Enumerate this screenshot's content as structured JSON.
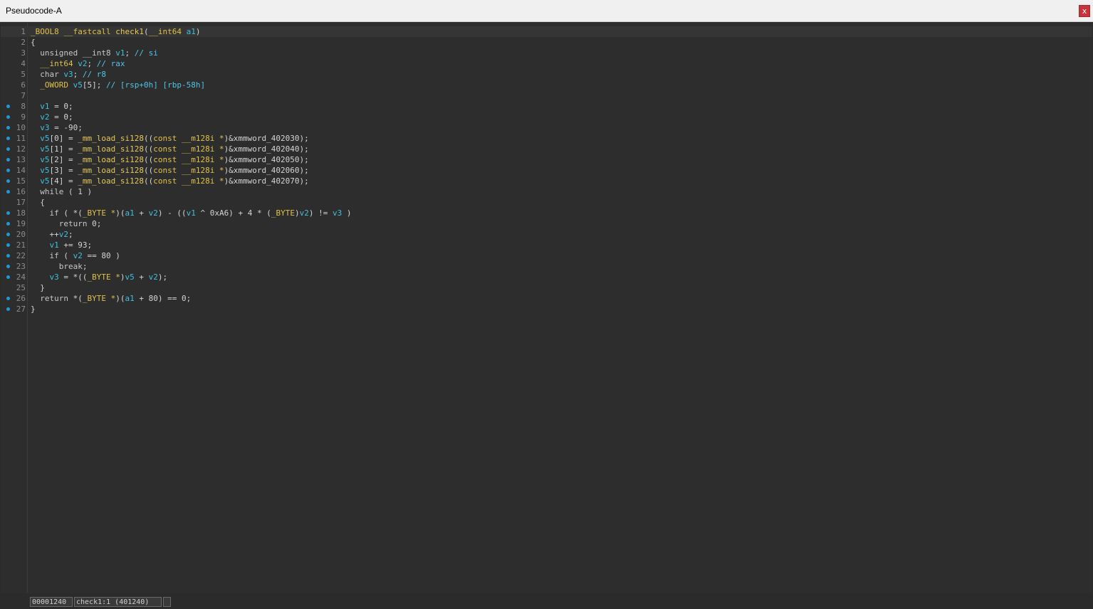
{
  "window": {
    "title": "Pseudocode-A",
    "close_label": "x"
  },
  "breakpoint_color": "#1e9bd7",
  "lines": [
    {
      "n": "1",
      "bp": false,
      "tokens": [
        [
          "type",
          "_BOOL8"
        ],
        [
          "plain",
          " "
        ],
        [
          "type",
          "__fastcall"
        ],
        [
          "plain",
          " "
        ],
        [
          "func",
          "check1"
        ],
        [
          "plain",
          "("
        ],
        [
          "type",
          "__int64"
        ],
        [
          "plain",
          " "
        ],
        [
          "var",
          "a1"
        ],
        [
          "plain",
          ")"
        ]
      ]
    },
    {
      "n": "2",
      "bp": false,
      "tokens": [
        [
          "plain",
          "{"
        ]
      ]
    },
    {
      "n": "3",
      "bp": false,
      "tokens": [
        [
          "plain",
          "  "
        ],
        [
          "kw",
          "unsigned __int8"
        ],
        [
          "plain",
          " "
        ],
        [
          "var",
          "v1"
        ],
        [
          "plain",
          "; "
        ],
        [
          "cmt",
          "// si"
        ]
      ]
    },
    {
      "n": "4",
      "bp": false,
      "tokens": [
        [
          "plain",
          "  "
        ],
        [
          "type",
          "__int64"
        ],
        [
          "plain",
          " "
        ],
        [
          "var",
          "v2"
        ],
        [
          "plain",
          "; "
        ],
        [
          "cmt",
          "// rax"
        ]
      ]
    },
    {
      "n": "5",
      "bp": false,
      "tokens": [
        [
          "plain",
          "  "
        ],
        [
          "kw",
          "char"
        ],
        [
          "plain",
          " "
        ],
        [
          "var",
          "v3"
        ],
        [
          "plain",
          "; "
        ],
        [
          "cmt",
          "// r8"
        ]
      ]
    },
    {
      "n": "6",
      "bp": false,
      "tokens": [
        [
          "plain",
          "  "
        ],
        [
          "type",
          "_OWORD"
        ],
        [
          "plain",
          " "
        ],
        [
          "var",
          "v5"
        ],
        [
          "plain",
          "[5]; "
        ],
        [
          "cmt",
          "// [rsp+0h] [rbp-58h]"
        ]
      ]
    },
    {
      "n": "7",
      "bp": false,
      "tokens": []
    },
    {
      "n": "8",
      "bp": true,
      "tokens": [
        [
          "plain",
          "  "
        ],
        [
          "var",
          "v1"
        ],
        [
          "plain",
          " = 0;"
        ]
      ]
    },
    {
      "n": "9",
      "bp": true,
      "tokens": [
        [
          "plain",
          "  "
        ],
        [
          "var",
          "v2"
        ],
        [
          "plain",
          " = 0;"
        ]
      ]
    },
    {
      "n": "10",
      "bp": true,
      "tokens": [
        [
          "plain",
          "  "
        ],
        [
          "var",
          "v3"
        ],
        [
          "plain",
          " = -90;"
        ]
      ]
    },
    {
      "n": "11",
      "bp": true,
      "tokens": [
        [
          "plain",
          "  "
        ],
        [
          "var",
          "v5"
        ],
        [
          "plain",
          "[0] = "
        ],
        [
          "func",
          "_mm_load_si128"
        ],
        [
          "plain",
          "(("
        ],
        [
          "type",
          "const __m128i *"
        ],
        [
          "plain",
          ")&xmmword_402030);"
        ]
      ]
    },
    {
      "n": "12",
      "bp": true,
      "tokens": [
        [
          "plain",
          "  "
        ],
        [
          "var",
          "v5"
        ],
        [
          "plain",
          "[1] = "
        ],
        [
          "func",
          "_mm_load_si128"
        ],
        [
          "plain",
          "(("
        ],
        [
          "type",
          "const __m128i *"
        ],
        [
          "plain",
          ")&xmmword_402040);"
        ]
      ]
    },
    {
      "n": "13",
      "bp": true,
      "tokens": [
        [
          "plain",
          "  "
        ],
        [
          "var",
          "v5"
        ],
        [
          "plain",
          "[2] = "
        ],
        [
          "func",
          "_mm_load_si128"
        ],
        [
          "plain",
          "(("
        ],
        [
          "type",
          "const __m128i *"
        ],
        [
          "plain",
          ")&xmmword_402050);"
        ]
      ]
    },
    {
      "n": "14",
      "bp": true,
      "tokens": [
        [
          "plain",
          "  "
        ],
        [
          "var",
          "v5"
        ],
        [
          "plain",
          "[3] = "
        ],
        [
          "func",
          "_mm_load_si128"
        ],
        [
          "plain",
          "(("
        ],
        [
          "type",
          "const __m128i *"
        ],
        [
          "plain",
          ")&xmmword_402060);"
        ]
      ]
    },
    {
      "n": "15",
      "bp": true,
      "tokens": [
        [
          "plain",
          "  "
        ],
        [
          "var",
          "v5"
        ],
        [
          "plain",
          "[4] = "
        ],
        [
          "func",
          "_mm_load_si128"
        ],
        [
          "plain",
          "(("
        ],
        [
          "type",
          "const __m128i *"
        ],
        [
          "plain",
          ")&xmmword_402070);"
        ]
      ]
    },
    {
      "n": "16",
      "bp": true,
      "tokens": [
        [
          "plain",
          "  "
        ],
        [
          "kw",
          "while"
        ],
        [
          "plain",
          " ( 1 )"
        ]
      ]
    },
    {
      "n": "17",
      "bp": false,
      "tokens": [
        [
          "plain",
          "  {"
        ]
      ]
    },
    {
      "n": "18",
      "bp": true,
      "tokens": [
        [
          "plain",
          "    "
        ],
        [
          "kw",
          "if"
        ],
        [
          "plain",
          " ( *("
        ],
        [
          "type",
          "_BYTE *"
        ],
        [
          "plain",
          ")("
        ],
        [
          "var",
          "a1"
        ],
        [
          "plain",
          " + "
        ],
        [
          "var",
          "v2"
        ],
        [
          "plain",
          ") - (("
        ],
        [
          "var",
          "v1"
        ],
        [
          "plain",
          " ^ 0xA6) + 4 * ("
        ],
        [
          "type",
          "_BYTE"
        ],
        [
          "plain",
          ")"
        ],
        [
          "var",
          "v2"
        ],
        [
          "plain",
          ") != "
        ],
        [
          "var",
          "v3"
        ],
        [
          "plain",
          " )"
        ]
      ]
    },
    {
      "n": "19",
      "bp": true,
      "tokens": [
        [
          "plain",
          "      "
        ],
        [
          "kw",
          "return"
        ],
        [
          "plain",
          " 0;"
        ]
      ]
    },
    {
      "n": "20",
      "bp": true,
      "tokens": [
        [
          "plain",
          "    ++"
        ],
        [
          "var",
          "v2"
        ],
        [
          "plain",
          ";"
        ]
      ]
    },
    {
      "n": "21",
      "bp": true,
      "tokens": [
        [
          "plain",
          "    "
        ],
        [
          "var",
          "v1"
        ],
        [
          "plain",
          " += 93;"
        ]
      ]
    },
    {
      "n": "22",
      "bp": true,
      "tokens": [
        [
          "plain",
          "    "
        ],
        [
          "kw",
          "if"
        ],
        [
          "plain",
          " ( "
        ],
        [
          "var",
          "v2"
        ],
        [
          "plain",
          " == 80 )"
        ]
      ]
    },
    {
      "n": "23",
      "bp": true,
      "tokens": [
        [
          "plain",
          "      "
        ],
        [
          "kw",
          "break"
        ],
        [
          "plain",
          ";"
        ]
      ]
    },
    {
      "n": "24",
      "bp": true,
      "tokens": [
        [
          "plain",
          "    "
        ],
        [
          "var",
          "v3"
        ],
        [
          "plain",
          " = *(("
        ],
        [
          "type",
          "_BYTE *"
        ],
        [
          "plain",
          ")"
        ],
        [
          "var",
          "v5"
        ],
        [
          "plain",
          " + "
        ],
        [
          "var",
          "v2"
        ],
        [
          "plain",
          ");"
        ]
      ]
    },
    {
      "n": "25",
      "bp": false,
      "tokens": [
        [
          "plain",
          "  }"
        ]
      ]
    },
    {
      "n": "26",
      "bp": true,
      "tokens": [
        [
          "plain",
          "  "
        ],
        [
          "kw",
          "return"
        ],
        [
          "plain",
          " *("
        ],
        [
          "type",
          "_BYTE *"
        ],
        [
          "plain",
          ")("
        ],
        [
          "var",
          "a1"
        ],
        [
          "plain",
          " + 80) == 0;"
        ]
      ]
    },
    {
      "n": "27",
      "bp": true,
      "tokens": [
        [
          "plain",
          "}"
        ]
      ]
    }
  ],
  "status": {
    "address": "00001240",
    "location": "check1:1 (401240)",
    "extra": ""
  }
}
